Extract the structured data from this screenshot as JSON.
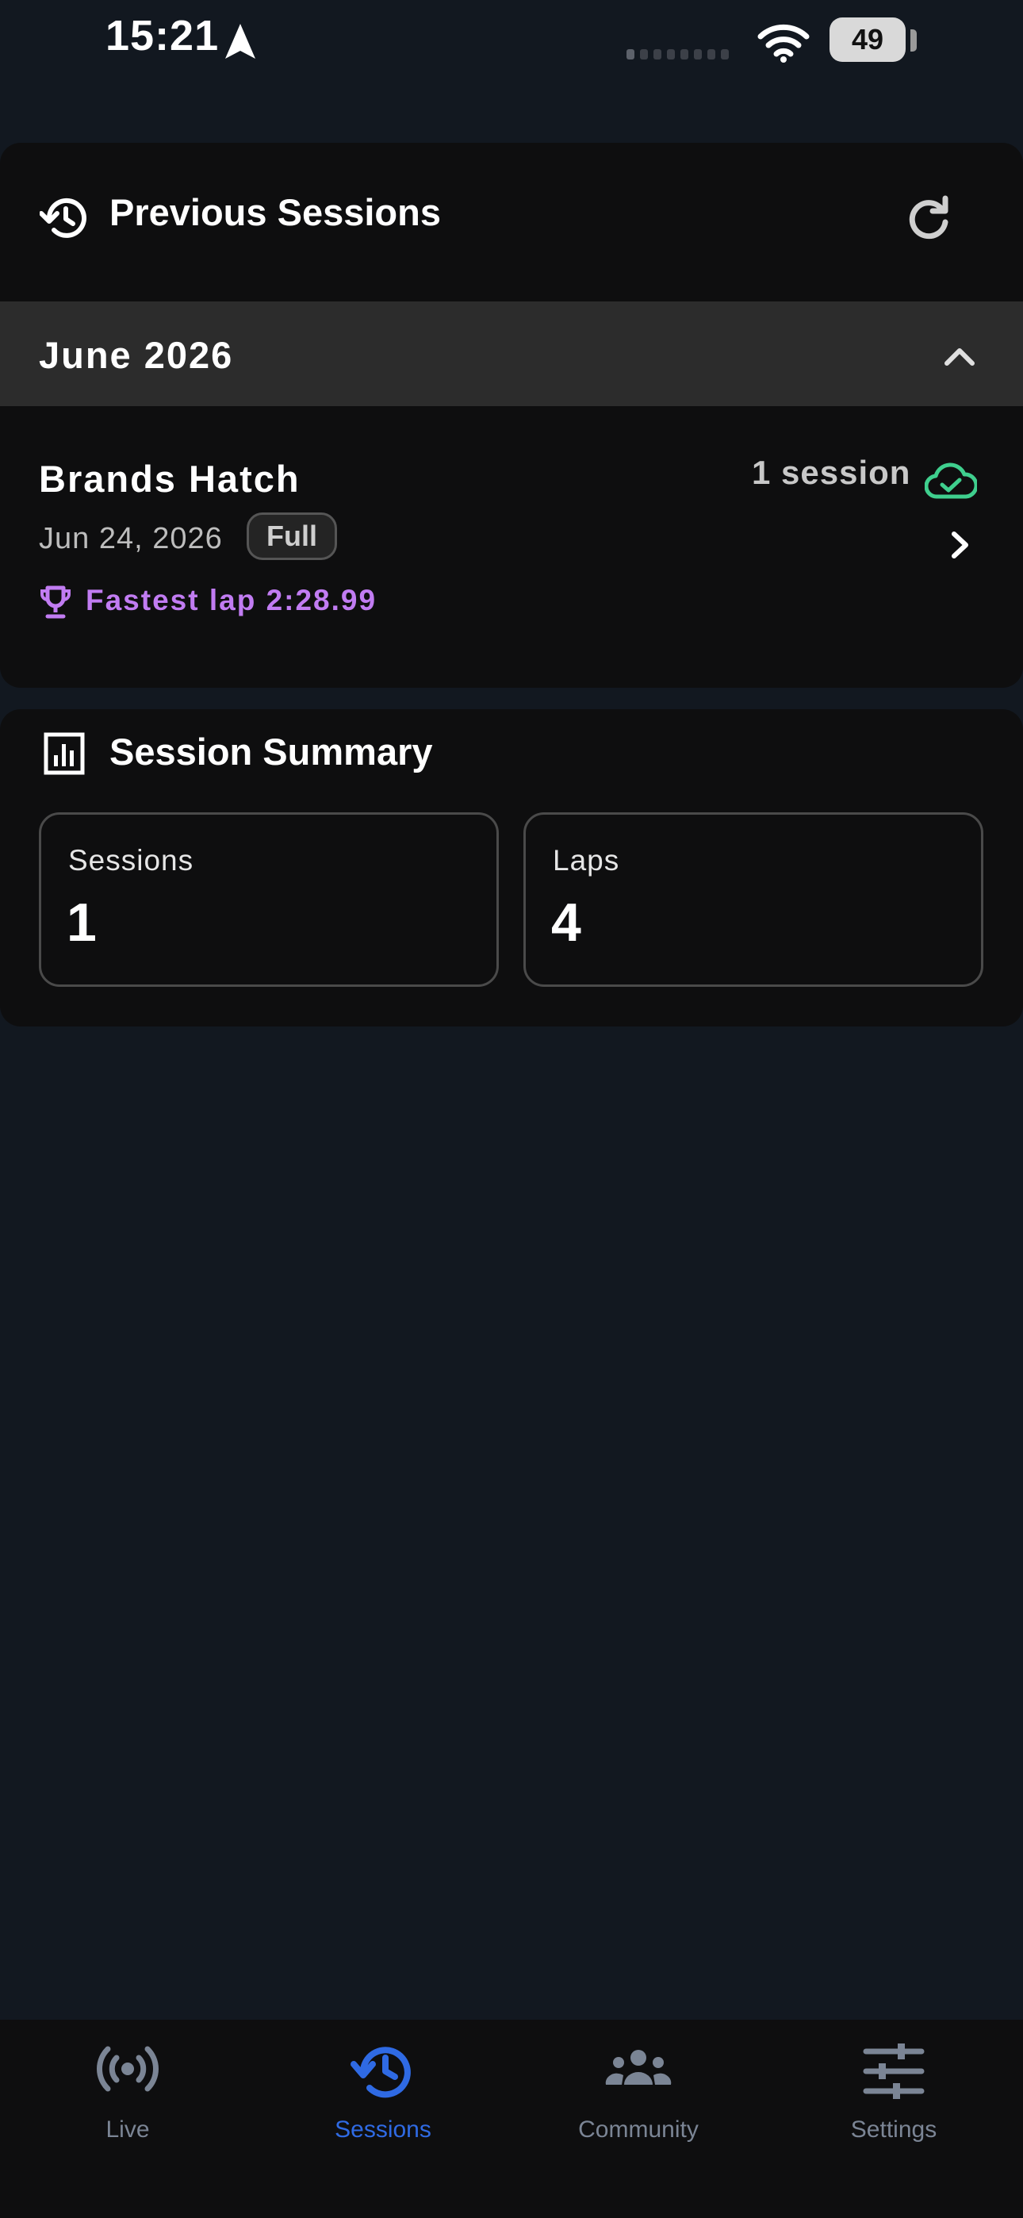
{
  "status_bar": {
    "time": "15:21",
    "battery": "49"
  },
  "header": {
    "title": "Previous Sessions"
  },
  "month_group": {
    "label": "June 2026",
    "sessions": [
      {
        "track": "Brands Hatch",
        "date": "Jun 24, 2026",
        "type": "Full",
        "fastest_lap": "Fastest lap 2:28.99",
        "count": "1 session"
      }
    ]
  },
  "summary": {
    "title": "Session Summary",
    "stats": [
      {
        "label": "Sessions",
        "value": "1"
      },
      {
        "label": "Laps",
        "value": "4"
      }
    ]
  },
  "nav": {
    "items": [
      {
        "label": "Live",
        "icon": "live-icon",
        "active": false
      },
      {
        "label": "Sessions",
        "icon": "history-icon",
        "active": true
      },
      {
        "label": "Community",
        "icon": "community-icon",
        "active": false
      },
      {
        "label": "Settings",
        "icon": "settings-icon",
        "active": false
      }
    ]
  },
  "colors": {
    "background": "#121820",
    "card": "#0e0e0f",
    "accent": "#2f6ae3",
    "fastest_lap": "#c17cf2",
    "synced": "#3fcf8e"
  }
}
